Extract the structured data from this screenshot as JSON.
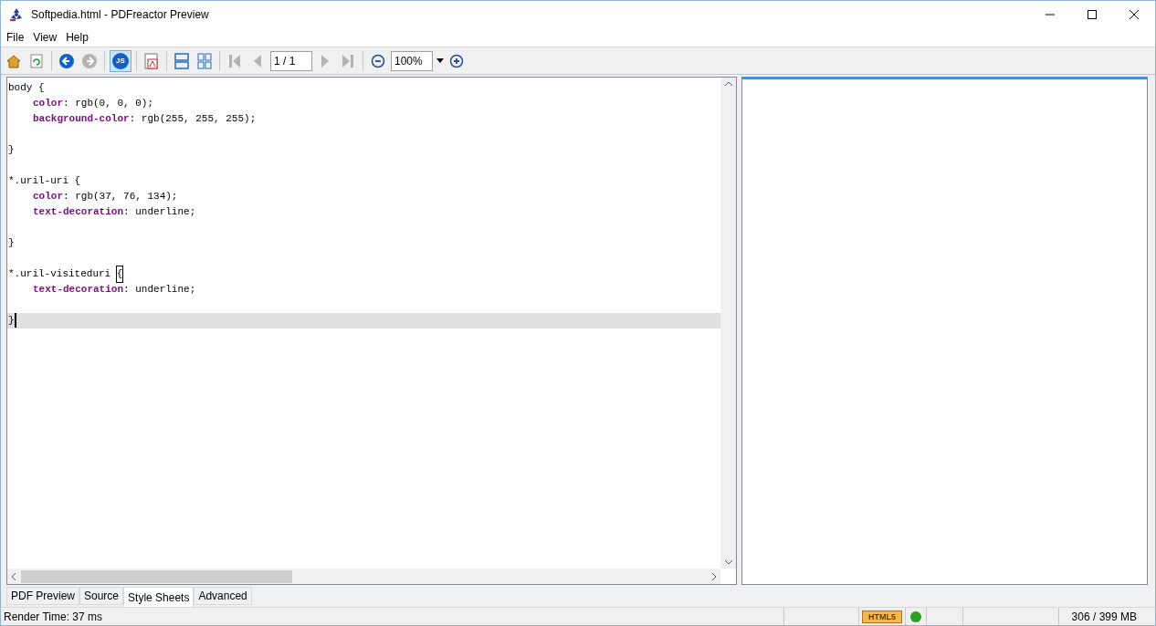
{
  "window": {
    "title": "Softpedia.html - PDFreactor Preview"
  },
  "menu": [
    "File",
    "View",
    "Help"
  ],
  "toolbar": [
    {
      "kind": "home",
      "disabled": false,
      "selected": false
    },
    {
      "kind": "reload",
      "disabled": false,
      "selected": false
    },
    {
      "kind": "sep"
    },
    {
      "kind": "back",
      "disabled": false,
      "selected": false
    },
    {
      "kind": "forward",
      "disabled": true,
      "selected": false
    },
    {
      "kind": "sep"
    },
    {
      "kind": "js",
      "disabled": false,
      "selected": true,
      "label": "JS"
    },
    {
      "kind": "sep"
    },
    {
      "kind": "pdf",
      "disabled": false,
      "selected": false
    },
    {
      "kind": "sep"
    },
    {
      "kind": "single",
      "disabled": false,
      "selected": false
    },
    {
      "kind": "grid",
      "disabled": false,
      "selected": false
    },
    {
      "kind": "sep"
    },
    {
      "kind": "first",
      "disabled": true,
      "selected": false
    },
    {
      "kind": "prev",
      "disabled": true,
      "selected": false
    },
    {
      "kind": "page",
      "value": "1 / 1"
    },
    {
      "kind": "next",
      "disabled": true,
      "selected": false
    },
    {
      "kind": "last",
      "disabled": true,
      "selected": false
    },
    {
      "kind": "sep"
    },
    {
      "kind": "zoomout",
      "disabled": false,
      "selected": false
    },
    {
      "kind": "zoom",
      "value": "100%"
    },
    {
      "kind": "zoomin",
      "disabled": false,
      "selected": false
    }
  ],
  "editor": {
    "lines": [
      {
        "current": false,
        "indent": false,
        "segments": [
          {
            "kind": "text",
            "text": "body {"
          }
        ]
      },
      {
        "current": false,
        "indent": true,
        "segments": [
          {
            "kind": "prop",
            "text": "color"
          },
          {
            "kind": "text",
            "text": ": rgb(0, 0, 0);"
          }
        ]
      },
      {
        "current": false,
        "indent": true,
        "segments": [
          {
            "kind": "prop",
            "text": "background-color"
          },
          {
            "kind": "text",
            "text": ": rgb(255, 255, 255);"
          }
        ]
      },
      {
        "current": false
      },
      {
        "current": false,
        "indent": false,
        "segments": [
          {
            "kind": "text",
            "text": "}"
          }
        ]
      },
      {
        "current": false
      },
      {
        "current": false,
        "indent": false,
        "segments": [
          {
            "kind": "text",
            "text": "*.uril-uri {"
          }
        ]
      },
      {
        "current": false,
        "indent": true,
        "segments": [
          {
            "kind": "prop",
            "text": "color"
          },
          {
            "kind": "text",
            "text": ": rgb(37, 76, 134);"
          }
        ]
      },
      {
        "current": false,
        "indent": true,
        "segments": [
          {
            "kind": "prop",
            "text": "text-decoration"
          },
          {
            "kind": "text",
            "text": ": underline;"
          }
        ]
      },
      {
        "current": false
      },
      {
        "current": false,
        "indent": false,
        "segments": [
          {
            "kind": "text",
            "text": "}"
          }
        ]
      },
      {
        "current": false
      },
      {
        "current": false,
        "indent": false,
        "segments": [
          {
            "kind": "text",
            "text": "*.uril-visiteduri "
          },
          {
            "kind": "match",
            "text": "{"
          }
        ]
      },
      {
        "current": false,
        "indent": true,
        "segments": [
          {
            "kind": "prop",
            "text": "text-decoration"
          },
          {
            "kind": "text",
            "text": ": underline;"
          }
        ]
      },
      {
        "current": false
      },
      {
        "current": true,
        "indent": false,
        "segments": [
          {
            "kind": "text",
            "text": "}"
          }
        ]
      }
    ]
  },
  "tabs": [
    {
      "label": "PDF Preview",
      "selected": false
    },
    {
      "label": "Source",
      "selected": false
    },
    {
      "label": "Style Sheets",
      "selected": true
    },
    {
      "label": "Advanced",
      "selected": false
    }
  ],
  "status_bar": {
    "render_time": "Render Time: 37 ms",
    "badge": "HTML5",
    "memory": "306 / 399 MB"
  }
}
